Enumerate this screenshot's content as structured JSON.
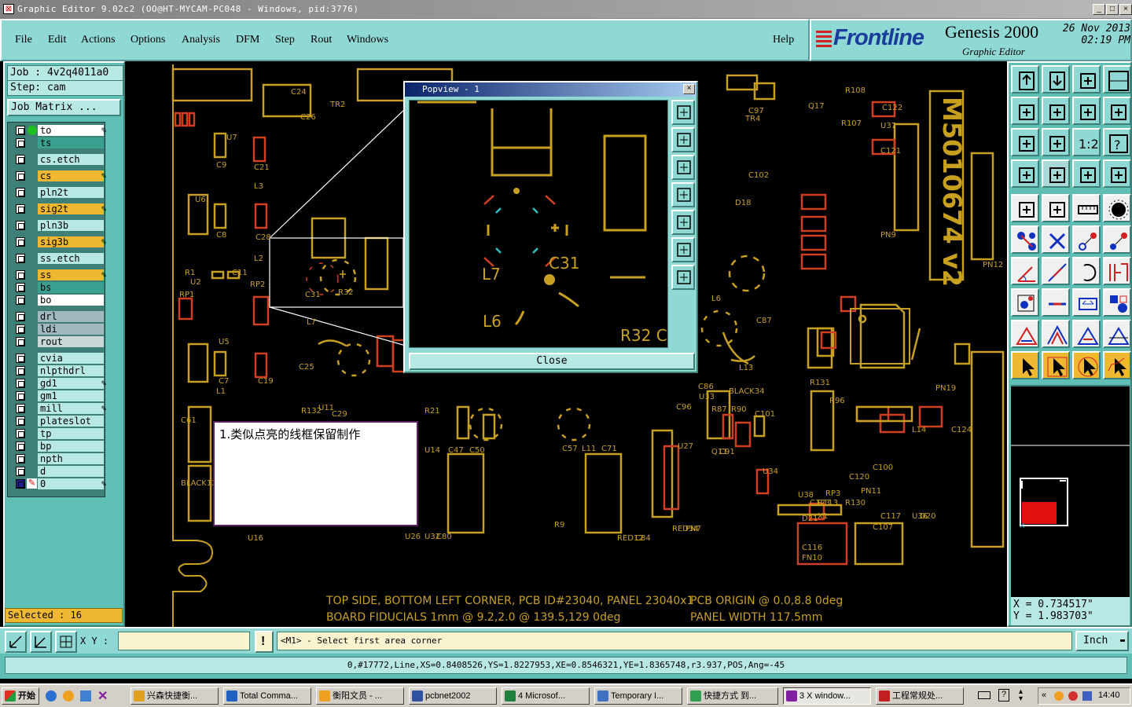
{
  "window": {
    "title": "Graphic Editor 9.02c2 (OO@HT-MYCAM-PC048 - Windows, pid:3776)",
    "controls": [
      "_",
      "□",
      "×"
    ]
  },
  "menu": {
    "items": [
      "File",
      "Edit",
      "Actions",
      "Options",
      "Analysis",
      "DFM",
      "Step",
      "Rout",
      "Windows"
    ],
    "help": "Help"
  },
  "brand": {
    "logo": "Frontline",
    "product": "Genesis 2000",
    "subtitle": "Graphic Editor",
    "date": "26 Nov 2013",
    "time": "02:19 PM"
  },
  "job": {
    "job_label": "Job : 4v2q4011a0",
    "step_label": "Step: cam",
    "matrix_button": "Job Matrix ..."
  },
  "layers": [
    {
      "name": "to",
      "color": "#ffffff",
      "pen": true
    },
    {
      "name": "ts",
      "color": "#3aa090",
      "pen": false
    },
    {
      "name": "cs.etch",
      "color": "#b8e8e4",
      "pen": false
    },
    {
      "name": "cs",
      "color": "#f0b830",
      "pen": true
    },
    {
      "name": "pln2t",
      "color": "#b8e8e4",
      "pen": false
    },
    {
      "name": "sig2t",
      "color": "#f0b830",
      "pen": true
    },
    {
      "name": "pln3b",
      "color": "#b8e8e4",
      "pen": false
    },
    {
      "name": "sig3b",
      "color": "#f0b830",
      "pen": true
    },
    {
      "name": "ss.etch",
      "color": "#b8e8e4",
      "pen": false
    },
    {
      "name": "ss",
      "color": "#f0b830",
      "pen": true
    },
    {
      "name": "bs",
      "color": "#3aa090",
      "pen": false
    },
    {
      "name": "bo",
      "color": "#ffffff",
      "pen": false
    },
    {
      "name": "drl",
      "color": "#a0b8c0",
      "pen": false
    },
    {
      "name": "ldi",
      "color": "#a0b8c0",
      "pen": false
    },
    {
      "name": "rout",
      "color": "#c8d8d8",
      "pen": false
    },
    {
      "name": "cvia",
      "color": "#b8e8e4",
      "pen": false
    },
    {
      "name": "nlpthdrl",
      "color": "#b8e8e4",
      "pen": false
    },
    {
      "name": "gd1",
      "color": "#b8e8e4",
      "pen": true
    },
    {
      "name": "gm1",
      "color": "#b8e8e4",
      "pen": false
    },
    {
      "name": "mill",
      "color": "#b8e8e4",
      "pen": true
    },
    {
      "name": "plateslot",
      "color": "#b8e8e4",
      "pen": false
    },
    {
      "name": "tp",
      "color": "#b8e8e4",
      "pen": false
    },
    {
      "name": "bp",
      "color": "#b8e8e4",
      "pen": false
    },
    {
      "name": "npth",
      "color": "#b8e8e4",
      "pen": false
    },
    {
      "name": "d",
      "color": "#b8e8e4",
      "pen": false
    },
    {
      "name": "0",
      "color": "#b8e8e4",
      "pen": true
    }
  ],
  "selected_label": "Selected : 16",
  "popview": {
    "title": "Popview - 1",
    "close_label": "Close",
    "labels": [
      "L7",
      "C31",
      "L6",
      "R32 C"
    ]
  },
  "note_text": "1.类似点亮的线框保留制作",
  "canvas": {
    "board_id": "M5010674 v2",
    "footer_line1": "TOP SIDE, BOTTOM LEFT CORNER, PCB ID#23040, PANEL 23040x1",
    "footer_line2": "BOARD FIDUCIALS 1mm @ 9.2,2.0 @ 139.5,129 0deg",
    "footer_right1": "PCB ORIGIN @ 0.0,8.8 0deg",
    "footer_right2": "PANEL WIDTH 117.5mm",
    "ref_labels": [
      "C24",
      "TR2",
      "C26",
      "R108",
      "Q17",
      "R107",
      "C122",
      "U37",
      "C121",
      "C97",
      "TR4",
      "C102",
      "D18",
      "PN9",
      "PN12",
      "R1",
      "C11",
      "RP2",
      "RP1",
      "U2",
      "C9",
      "C21",
      "L3",
      "U6",
      "C8",
      "C28",
      "L2",
      "U7",
      "U5",
      "C7",
      "C19",
      "L1",
      "C25",
      "R32",
      "C31",
      "L7",
      "L6",
      "C87",
      "L13",
      "C96",
      "C86",
      "U33",
      "R87",
      "R90",
      "C101",
      "R96",
      "R131",
      "PN19",
      "C124",
      "R132",
      "U11",
      "C29",
      "R21",
      "U14",
      "C47",
      "C50",
      "C57",
      "L11",
      "C71",
      "U27",
      "Q11",
      "C91",
      "U34",
      "C100",
      "C120",
      "L14",
      "U36",
      "C117",
      "X1",
      "RP3",
      "PN11",
      "U38",
      "C123",
      "R113",
      "R130",
      "C107",
      "D20",
      "D21",
      "C116",
      "FN10",
      "RED34",
      "PN7",
      "RED12",
      "C84",
      "U32",
      "U26",
      "C80",
      "U16",
      "R9",
      "C61",
      "BLACK12",
      "BLACK34"
    ]
  },
  "coords": {
    "x_label": "X = 0.734517\"",
    "y_label": "Y = 1.983703\""
  },
  "bottombar": {
    "xy_label": "X Y :",
    "xy_value": "",
    "prompt": "<M1> - Select first area corner",
    "units": "Inch"
  },
  "status_line": "0,#17772,Line,XS=0.8408526,YS=1.8227953,XE=0.8546321,YE=1.8365748,r3.937,POS,Ang=-45",
  "taskbar": {
    "start": "开始",
    "tasks": [
      {
        "label": "兴森快捷衡...",
        "color": "#e0a020"
      },
      {
        "label": "Total Comma...",
        "color": "#2060c0"
      },
      {
        "label": "衡阳文员 - ...",
        "color": "#f0a020"
      },
      {
        "label": "pcbnet2002",
        "color": "#3050a0"
      },
      {
        "label": "4 Microsof...",
        "color": "#208040"
      },
      {
        "label": "Temporary I...",
        "color": "#4070c0"
      },
      {
        "label": "快捷方式 到...",
        "color": "#30a050"
      },
      {
        "label": "3 X window...",
        "color": "#8020a0"
      },
      {
        "label": "工程常规处...",
        "color": "#c02020"
      }
    ],
    "clock": "14:40"
  },
  "colors": {
    "panel": "#5fbfb4",
    "panel_light": "#8fd8d4",
    "field": "#b8e8e4",
    "highlight": "#f0b830",
    "trace": "#c8a020",
    "pad_red": "#d04020"
  }
}
